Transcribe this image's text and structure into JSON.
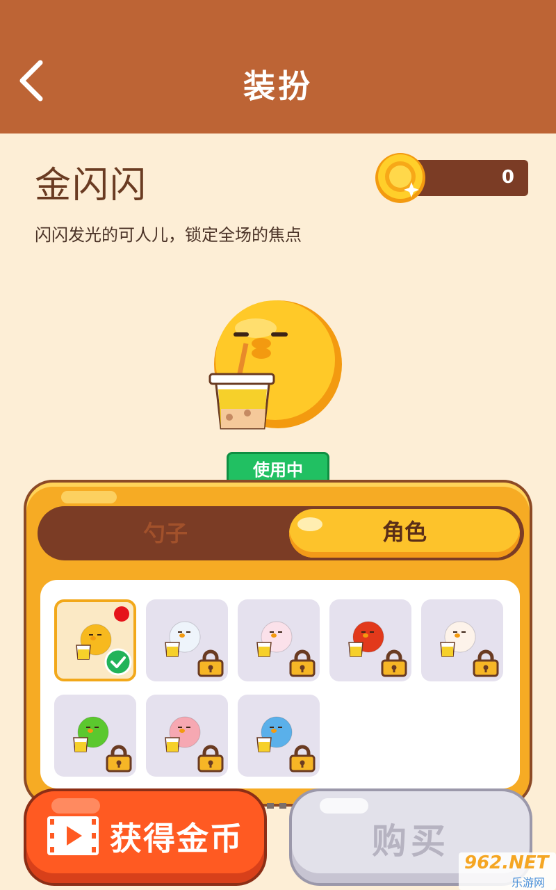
{
  "header": {
    "title": "装扮"
  },
  "item": {
    "name": "金闪闪",
    "description": "闪闪发光的可人儿，锁定全场的焦点",
    "status_badge": "使用中"
  },
  "coins": {
    "count": "0"
  },
  "tabs": [
    {
      "label": "勺子",
      "active": false
    },
    {
      "label": "角色",
      "active": true
    }
  ],
  "characters": [
    {
      "name": "yellow-chick",
      "color": "#f7b91e",
      "locked": false,
      "selected": true,
      "new": true
    },
    {
      "name": "rainbow-cloud",
      "color": "#eef4fb",
      "locked": true
    },
    {
      "name": "bunny",
      "color": "#fbe1ea",
      "locked": true
    },
    {
      "name": "devil",
      "color": "#e2391b",
      "locked": true
    },
    {
      "name": "chicken",
      "color": "#fdf3ea",
      "locked": true
    },
    {
      "name": "green",
      "color": "#5bc82e",
      "locked": true
    },
    {
      "name": "pink",
      "color": "#f6a8b2",
      "locked": true
    },
    {
      "name": "blue",
      "color": "#5ab0ea",
      "locked": true
    }
  ],
  "buttons": {
    "get_coins": "获得金币",
    "buy": "购买"
  },
  "watermark": {
    "top": "962.NET",
    "bottom": "乐游网"
  },
  "icons": {
    "back": "back-arrow-icon",
    "coin": "coin-icon",
    "video": "video-icon",
    "lock": "lock-icon",
    "check": "check-icon"
  }
}
